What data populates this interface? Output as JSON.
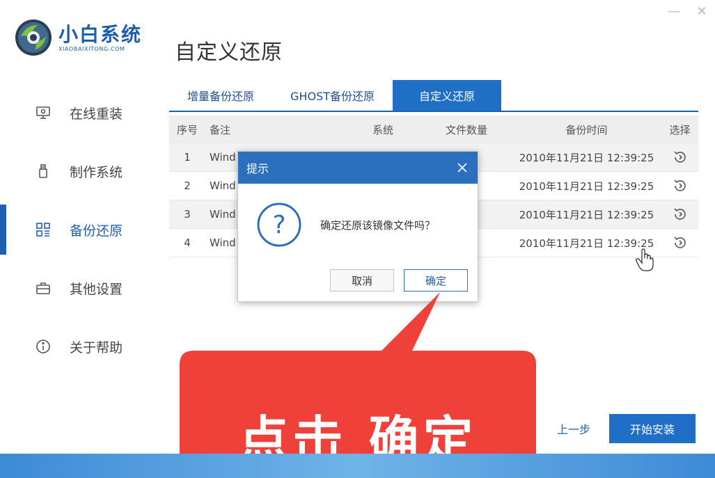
{
  "window": {
    "minimize_glyph": "—",
    "close_glyph": "✕"
  },
  "logo": {
    "name": "小白系统",
    "domain": "XIAOBAIXITONG.COM"
  },
  "page_title": "自定义还原",
  "sidebar": {
    "items": [
      {
        "label": "在线重装",
        "icon": "monitor-icon"
      },
      {
        "label": "制作系统",
        "icon": "usb-drive-icon"
      },
      {
        "label": "备份还原",
        "icon": "grid-icon"
      },
      {
        "label": "其他设置",
        "icon": "briefcase-icon"
      },
      {
        "label": "关于帮助",
        "icon": "info-icon"
      }
    ]
  },
  "tabs": [
    {
      "label": "增量备份还原"
    },
    {
      "label": "GHOST备份还原"
    },
    {
      "label": "自定义还原"
    }
  ],
  "table": {
    "headers": {
      "no": "序号",
      "note": "备注",
      "sys": "系统",
      "count": "文件数量",
      "time": "备份时间",
      "sel": "选择"
    },
    "rows": [
      {
        "no": "1",
        "note": "Wind",
        "sys": "",
        "count": "",
        "time": "2010年11月21日 12:39:25"
      },
      {
        "no": "2",
        "note": "Wind",
        "sys": "",
        "count": "",
        "time": "2010年11月21日 12:39:25"
      },
      {
        "no": "3",
        "note": "Wind",
        "sys": "",
        "count": "",
        "time": "2010年11月21日 12:39:25"
      },
      {
        "no": "4",
        "note": "Wind",
        "sys": "",
        "count": "",
        "time": "2010年11月21日 12:39:25"
      }
    ]
  },
  "dialog": {
    "title": "提示",
    "message": "确定还原该镜像文件吗？",
    "cancel": "取消",
    "ok": "确定"
  },
  "callout": {
    "text": "点击 确定"
  },
  "footer": {
    "prev": "上一步",
    "start": "开始安装"
  },
  "colors": {
    "accent": "#1e6fc5",
    "callout": "#f0403a"
  }
}
